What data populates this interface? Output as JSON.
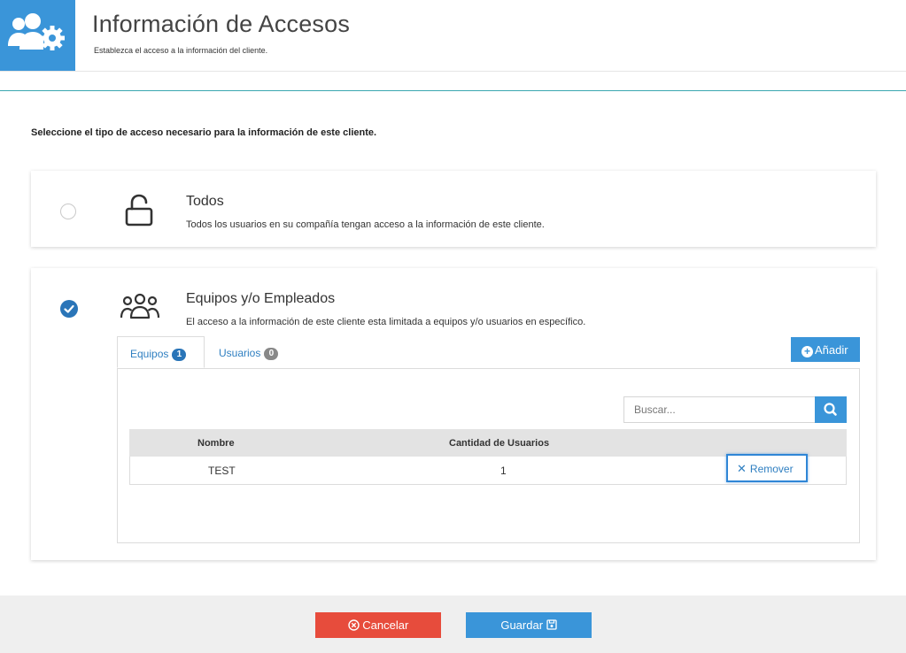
{
  "header": {
    "title": "Información de Accesos",
    "subtitle": "Establezca el acceso a la información del cliente.",
    "icon": "users-gear-icon",
    "accent_color": "#3a95d9"
  },
  "instruction": "Seleccione el tipo de acceso necesario para la información de este cliente.",
  "options": [
    {
      "title": "Todos",
      "description": "Todos los usuarios en su compañía tengan acceso a la información de este cliente.",
      "icon": "unlock-icon",
      "selected": false
    },
    {
      "title": "Equipos y/o Empleados",
      "description": "El acceso a la información de este cliente esta limitada a equipos y/o usuarios en específico.",
      "icon": "group-icon",
      "selected": true
    }
  ],
  "tabs": [
    {
      "label": "Equipos",
      "count": "1",
      "active": true
    },
    {
      "label": "Usuarios",
      "count": "0",
      "active": false
    }
  ],
  "add_button": "Añadir",
  "search": {
    "placeholder": "Buscar..."
  },
  "table": {
    "columns": [
      "Nombre",
      "Cantidad de Usuarios"
    ],
    "rows": [
      {
        "name": "TEST",
        "count": "1",
        "action": "Remover"
      }
    ]
  },
  "footer": {
    "cancel_label": "Cancelar",
    "save_label": "Guardar",
    "cancel_color": "#e74c3c",
    "save_color": "#3a95d9"
  }
}
